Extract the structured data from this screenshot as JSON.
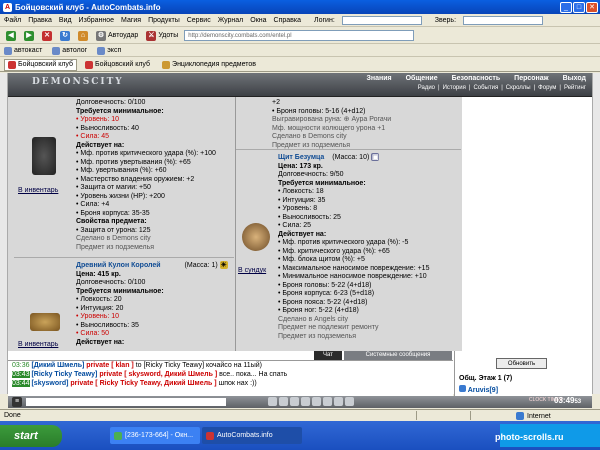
{
  "window": {
    "title": "Бойцовский клуб - AutoCombats.info",
    "app_icon": "A"
  },
  "menu": {
    "items": [
      "Файл",
      "Правка",
      "Вид",
      "Избранное",
      "Магия",
      "Продукты",
      "Сервис",
      "Журнал",
      "Окна",
      "Справка"
    ],
    "login_label": "Логин:",
    "beast_label": "Зверь:"
  },
  "toolbar": {
    "autoudar": "Автоудар",
    "udary": "Удоты",
    "address": "http://demonscity.combats.com/entel.pl"
  },
  "links": {
    "items": [
      "автокаст",
      "автолог",
      "эксп"
    ]
  },
  "favorites": {
    "items": [
      "Бойцовский клуб",
      "Бойцовский клуб",
      "Энциклопедия предметов"
    ]
  },
  "game": {
    "logo": "DEMONSCITY",
    "nav_top": [
      "Знания",
      "Общение",
      "Безопасность",
      "Персонаж",
      "Выход"
    ],
    "nav_sub": [
      "Радио",
      "|",
      "История",
      "|",
      "События",
      "|",
      "Скроллы",
      "|",
      "Форум",
      "|",
      "Рейтинг"
    ]
  },
  "left_panel": {
    "item1": {
      "lines": [
        {
          "t": "Долговечность: 0/100",
          "c": ""
        },
        {
          "t": "Требуется минимальное:",
          "c": "hdr"
        },
        {
          "t": "• Уровень: 10",
          "c": "red"
        },
        {
          "t": "• Выносливость: 40",
          "c": ""
        },
        {
          "t": "• Сила: 45",
          "c": "red"
        },
        {
          "t": "Действует на:",
          "c": "hdr"
        },
        {
          "t": "• Мф. против критического удара (%): +100",
          "c": ""
        },
        {
          "t": "• Мф. против увертывания (%): +65",
          "c": ""
        },
        {
          "t": "• Мф. увертывания (%): +60",
          "c": ""
        },
        {
          "t": "• Мастерство владения оружием: +2",
          "c": ""
        },
        {
          "t": "• Защита от магии: +50",
          "c": ""
        },
        {
          "t": "• Уровень жизни (HP): +200",
          "c": ""
        },
        {
          "t": "• Сила: +4",
          "c": ""
        },
        {
          "t": "• Броня корпуса: 35-35",
          "c": ""
        },
        {
          "t": "Свойства предмета:",
          "c": "hdr"
        },
        {
          "t": "• Защита от урона: 125",
          "c": ""
        },
        {
          "t": "Сделано в Demons city",
          "c": "small"
        },
        {
          "t": "Предмет из подземелья",
          "c": "small red"
        }
      ],
      "link": "В инвентарь"
    },
    "item2": {
      "title": "Древний Кулон Королей",
      "mass": "(Масса: 1)",
      "lines": [
        {
          "t": "Цена: 415 кр.",
          "c": "price"
        },
        {
          "t": "Долговечность: 0/100",
          "c": ""
        },
        {
          "t": "Требуется минимальное:",
          "c": "hdr"
        },
        {
          "t": "• Ловкость: 20",
          "c": ""
        },
        {
          "t": "• Интуиция: 20",
          "c": ""
        },
        {
          "t": "• Уровень: 10",
          "c": "red"
        },
        {
          "t": "• Выносливость: 35",
          "c": ""
        },
        {
          "t": "• Сила: 50",
          "c": "red"
        },
        {
          "t": "Действует на:",
          "c": "hdr"
        }
      ],
      "link": "В инвентарь"
    }
  },
  "right_panel": {
    "top_lines": [
      {
        "t": "+2",
        "c": ""
      },
      {
        "t": "• Броня головы: 5-16 (4+d12)",
        "c": ""
      },
      {
        "t": "Выгравирована руна: ⊕ Аура Рогачи",
        "c": "small"
      },
      {
        "t": "Мф. мощности колющего урона +1",
        "c": "small"
      },
      {
        "t": "Сделано в Demons city",
        "c": "small"
      },
      {
        "t": "Предмет из подземелья",
        "c": "small red"
      }
    ],
    "item": {
      "title": "Щит Безумца",
      "mass": "(Масса: 10)",
      "lines": [
        {
          "t": "Цена: 173 кр.",
          "c": "price"
        },
        {
          "t": "Долговечность: 9/50",
          "c": ""
        },
        {
          "t": "Требуется минимальное:",
          "c": "hdr"
        },
        {
          "t": "• Ловкость: 18",
          "c": ""
        },
        {
          "t": "• Интуиция: 35",
          "c": ""
        },
        {
          "t": "• Уровень: 8",
          "c": ""
        },
        {
          "t": "• Выносливость: 25",
          "c": ""
        },
        {
          "t": "• Сила: 25",
          "c": ""
        },
        {
          "t": "Действует на:",
          "c": "hdr"
        },
        {
          "t": "• Мф. против критического удара (%): -5",
          "c": ""
        },
        {
          "t": "• Мф. критического удара (%): +65",
          "c": ""
        },
        {
          "t": "• Мф. блока щитом (%): +5",
          "c": ""
        },
        {
          "t": "• Максимальное наносимое повреждение: +15",
          "c": ""
        },
        {
          "t": "• Минимальное наносимое повреждение: +10",
          "c": ""
        },
        {
          "t": "• Броня головы: 5-22 (4+d18)",
          "c": ""
        },
        {
          "t": "• Броня корпуса: 6-23 (5+d18)",
          "c": ""
        },
        {
          "t": "• Броня пояса: 5-22 (4+d18)",
          "c": ""
        },
        {
          "t": "• Броня ног: 5-22 (4+d18)",
          "c": ""
        },
        {
          "t": "Сделано в Angels city",
          "c": "small"
        },
        {
          "t": "Предмет не подлежит ремонту",
          "c": "small red"
        },
        {
          "t": "Предмет из подземелья",
          "c": "small red"
        }
      ],
      "link": "В сундук"
    }
  },
  "chat_tabs": {
    "chat": "Чат",
    "system": "Системные сообщения"
  },
  "chat": [
    {
      "time": "03:36",
      "hl": false,
      "who": "[Дикий Шмель]",
      "priv": "private [ klan ]",
      "text": "to [Ricky Ticky Teawy] кочайсо на 11ый)"
    },
    {
      "time": "03:43",
      "hl": true,
      "who": "[Ricky Ticky Teawy]",
      "priv": "private [ skysword, Дикий Шмель ]",
      "text": "все.. пока... На спать"
    },
    {
      "time": "03:44",
      "hl": true,
      "who": "[skysword]",
      "priv": "private [ Ricky Ticky Teawy, Дикий Шмель ]",
      "text": "шпок нах :))"
    }
  ],
  "room": {
    "refresh": "Обновить",
    "title": "Общ. Этаж 1 (7)",
    "user": "Aruvis[9]"
  },
  "bottombar": {
    "time": "03:49",
    "seconds": "53",
    "clock": "CLOCK TIMER"
  },
  "status": {
    "text": "Done",
    "zone": "Internet"
  },
  "taskbar": {
    "start": "start",
    "tasks": [
      "[236-173-664] - Окн...",
      "AutoCombats.info"
    ]
  },
  "watermark": "photo-scrolls.ru",
  "colors": {
    "accent": "#0a5fe0",
    "link": "#104c94",
    "alert": "#cc0000"
  }
}
